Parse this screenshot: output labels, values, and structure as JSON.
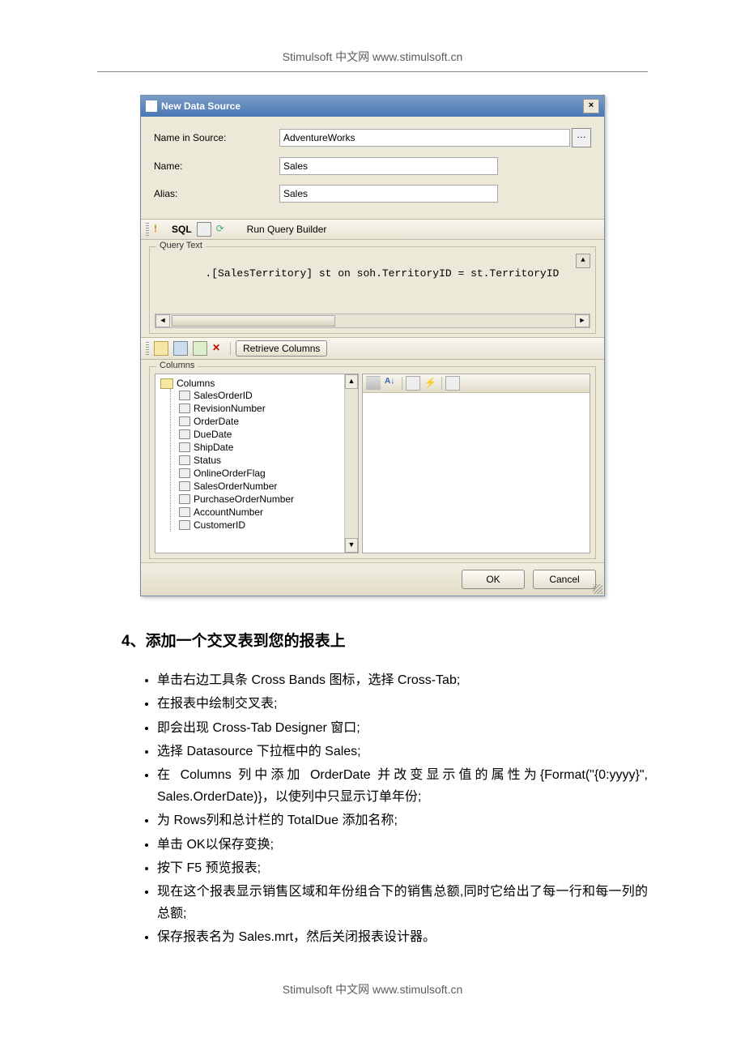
{
  "header": "Stimulsoft 中文网 www.stimulsoft.cn",
  "footer": "Stimulsoft 中文网 www.stimulsoft.cn",
  "dialog": {
    "title": "New Data Source",
    "name_in_source_label": "Name in Source:",
    "name_in_source_value": "AdventureWorks",
    "name_label": "Name:",
    "name_value": "Sales",
    "alias_label": "Alias:",
    "alias_value": "Sales",
    "sql_label": "SQL",
    "run_query_builder": "Run Query Builder",
    "query_group": "Query Text",
    "query_text": ".[SalesTerritory] st on soh.TerritoryID = st.TerritoryID",
    "retrieve_columns": "Retrieve Columns",
    "columns_group": "Columns",
    "tree_root": "Columns",
    "columns": [
      "SalesOrderID",
      "RevisionNumber",
      "OrderDate",
      "DueDate",
      "ShipDate",
      "Status",
      "OnlineOrderFlag",
      "SalesOrderNumber",
      "PurchaseOrderNumber",
      "AccountNumber",
      "CustomerID"
    ],
    "ok": "OK",
    "cancel": "Cancel"
  },
  "article": {
    "heading": "4、添加一个交叉表到您的报表上",
    "bullets": [
      "单击右边工具条 Cross Bands 图标，选择 Cross-Tab;",
      "在报表中绘制交叉表;",
      "即会出现 Cross-Tab Designer 窗口;",
      "选择 Datasource 下拉框中的 Sales;",
      "在 Columns 列中添加 OrderDate 并改变显示值的属性为{Format(\"{0:yyyy}\", Sales.OrderDate)}，以使列中只显示订单年份;",
      "为 Rows列和总计栏的 TotalDue 添加名称;",
      "单击 OK以保存变换;",
      "按下 F5 预览报表;",
      "现在这个报表显示销售区域和年份组合下的销售总额,同时它给出了每一行和每一列的总额;",
      "保存报表名为 Sales.mrt，然后关闭报表设计器。"
    ]
  }
}
